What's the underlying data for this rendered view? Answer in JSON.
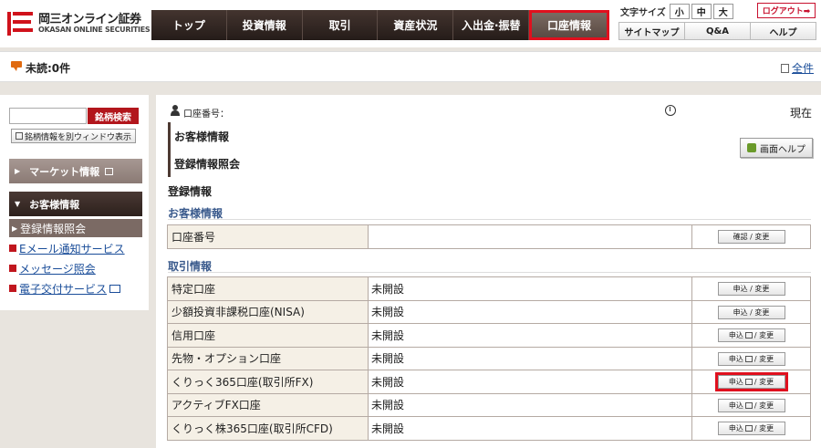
{
  "header": {
    "logo_name": "岡三オンライン証券",
    "logo_sub": "OKASAN ONLINE SECURITIES",
    "nav": [
      "トップ",
      "投資情報",
      "取引",
      "資産状況",
      "入出金·振替",
      "口座情報"
    ],
    "font_size_label": "文字サイズ",
    "font_sizes": [
      "小",
      "中",
      "大"
    ],
    "logout": "ログアウト➡",
    "util_links": [
      "サイトマップ",
      "Q&A",
      "ヘルプ"
    ]
  },
  "notice": {
    "text": "未読:0件",
    "all_link": "全件"
  },
  "sidebar": {
    "search_button": "銘柄検索",
    "new_window": "銘柄情報を別ウィンドウ表示",
    "market_head": "マーケット情報",
    "account_head": "お客様情報",
    "items": [
      "登録情報照会",
      "Eメール通知サービス",
      "メッセージ照会",
      "電子交付サービス"
    ]
  },
  "main": {
    "account_label": "口座番号：",
    "now_label": "現在",
    "heading1": "お客様情報",
    "heading2": "登録情報照会",
    "help_button": "画面ヘルプ",
    "reg_title": "登録情報",
    "section1": "お客様情報",
    "section2": "取引情報",
    "table1": [
      {
        "label": "口座番号",
        "value": "",
        "action": "確認 / 変更"
      }
    ],
    "table2": [
      {
        "label": "特定口座",
        "value": "未開設",
        "action_left": "申込",
        "action_right": "/ 変更"
      },
      {
        "label": "少額投資非課税口座(NISA)",
        "value": "未開設",
        "action_left": "申込",
        "action_right": "/ 変更"
      },
      {
        "label": "信用口座",
        "value": "未開設",
        "action_left": "申込",
        "action_right": "/ 変更"
      },
      {
        "label": "先物・オプション口座",
        "value": "未開設",
        "action_left": "申込",
        "action_right": "/ 変更"
      },
      {
        "label": "くりっく365口座(取引所FX)",
        "value": "未開設",
        "action_left": "申込",
        "action_right": "/ 変更"
      },
      {
        "label": "アクティブFX口座",
        "value": "未開設",
        "action_left": "申込",
        "action_right": "/ 変更"
      },
      {
        "label": "くりっく株365口座(取引所CFD)",
        "value": "未開設",
        "action_left": "申込",
        "action_right": "/ 変更"
      }
    ]
  },
  "colors": {
    "accent_red": "#e0101e",
    "nav_dark": "#2e2421",
    "link_blue": "#1a4d99"
  }
}
